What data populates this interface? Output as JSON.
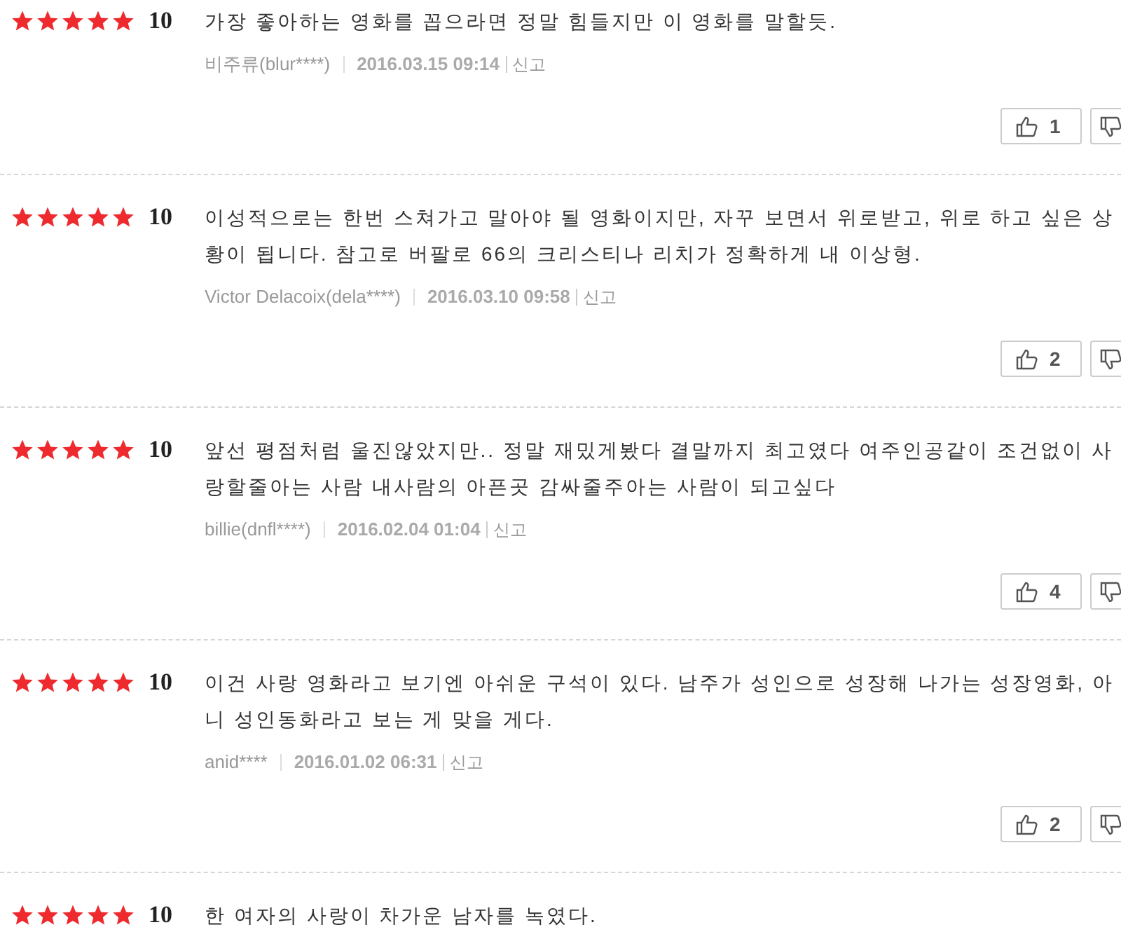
{
  "reviews": [
    {
      "stars": 5,
      "score": "10",
      "text": "가장 좋아하는 영화를 꼽으라면 정말 힘들지만 이 영화를 말할듯.",
      "author": "비주류(blur****)",
      "date": "2016.03.15 09:14",
      "report": "신고",
      "likes": "1"
    },
    {
      "stars": 5,
      "score": "10",
      "text": "이성적으로는 한번 스쳐가고 말아야 될 영화이지만, 자꾸 보면서 위로받고, 위로 하고 싶은 상황이 됩니다. 참고로 버팔로 66의 크리스티나 리치가 정확하게 내 이상형.",
      "author": "Victor Delacoix(dela****)",
      "date": "2016.03.10 09:58",
      "report": "신고",
      "likes": "2"
    },
    {
      "stars": 5,
      "score": "10",
      "text": "앞선 평점처럼 울진않았지만.. 정말 재밌게봤다 결말까지 최고였다 여주인공같이 조건없이 사랑할줄아는 사람 내사람의 아픈곳 감싸줄주아는 사람이 되고싶다",
      "author": "billie(dnfl****)",
      "date": "2016.02.04 01:04",
      "report": "신고",
      "likes": "4"
    },
    {
      "stars": 5,
      "score": "10",
      "text": "이건 사랑 영화라고 보기엔 아쉬운 구석이 있다. 남주가 성인으로 성장해 나가는 성장영화, 아니 성인동화라고 보는 게 맞을 게다.",
      "author": "anid****",
      "date": "2016.01.02 06:31",
      "report": "신고",
      "likes": "2"
    },
    {
      "stars": 5,
      "score": "10",
      "text": "한 여자의 사랑이 차가운 남자를 녹였다."
    }
  ]
}
